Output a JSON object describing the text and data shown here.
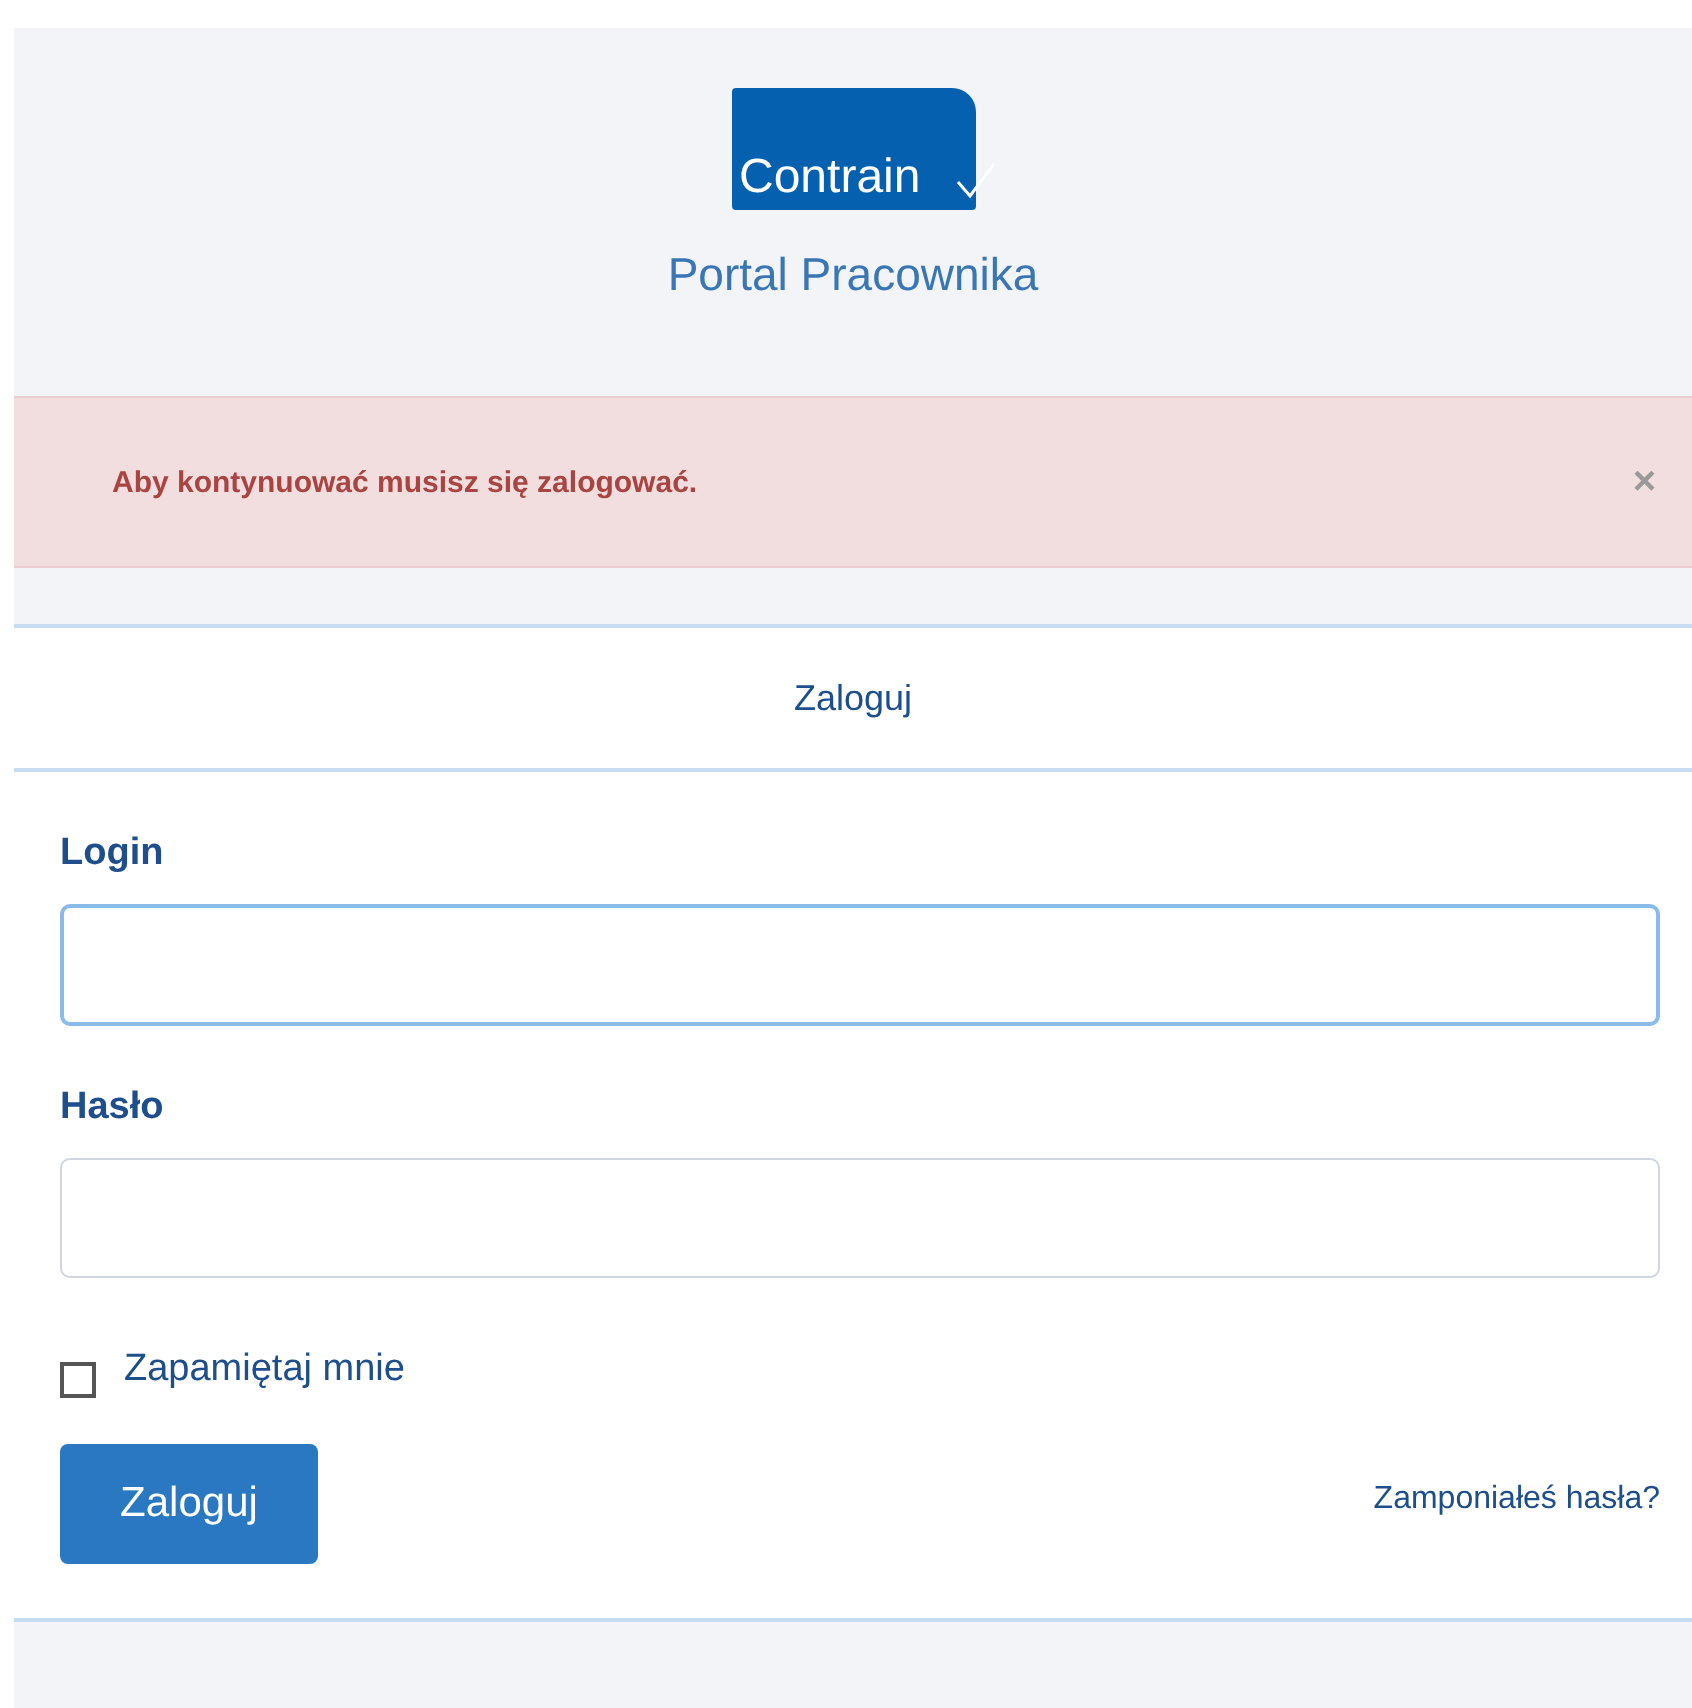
{
  "logo": {
    "text": "Contrain"
  },
  "subtitle": "Portal Pracownika",
  "alert": {
    "message": "Aby kontynuować musisz się zalogować.",
    "close": "×"
  },
  "panel": {
    "title": "Zaloguj"
  },
  "fields": [
    {
      "label": "Login",
      "focused": true
    },
    {
      "label": "Hasło",
      "focused": false
    }
  ],
  "remember": {
    "label": "Zapamiętaj mnie",
    "checked": false
  },
  "submit": "Zaloguj",
  "forgot": "Zamponiałeś hasła?"
}
